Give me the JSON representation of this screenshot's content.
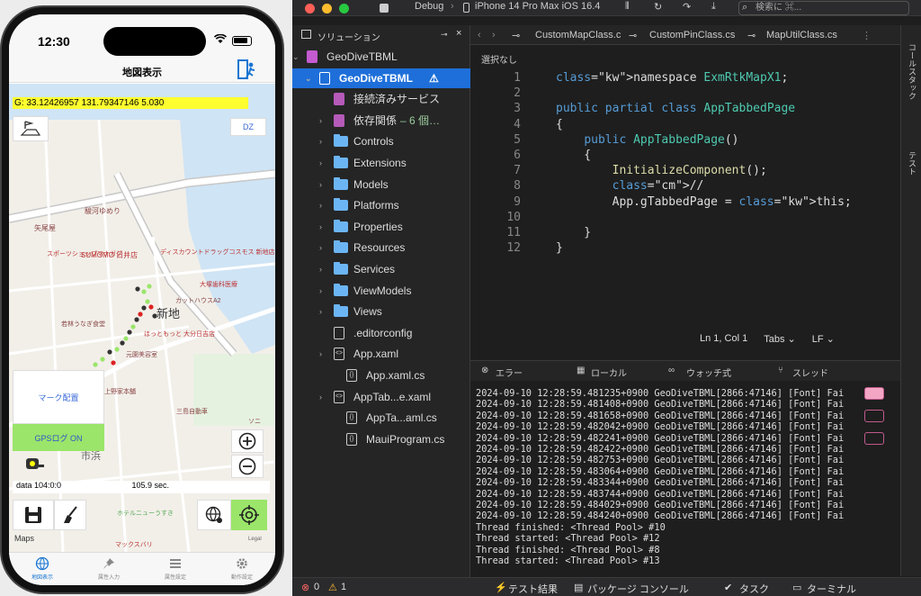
{
  "phone": {
    "time": "12:30",
    "nav_title": "地図表示",
    "gps_text": "G: 33.12426957 131.79347146 5.030",
    "dz_label": "DZ",
    "mark_label": "マーク配置",
    "gpslog_label": "GPSログ ON",
    "data_text": "data 104:0:0",
    "seconds_text": "105.9 sec.",
    "maps_label": "Maps",
    "legal_label": "Legal",
    "map_labels": [
      "新地",
      "市浜",
      "駿河ゆめり",
      "矢尾屋",
      "SUMOMO 日井店",
      "ディスカウントドラッグコスモス 新地店",
      "スポーツショップマナガグ",
      "大塚歯科医療",
      "カットハウスA2",
      "ほっともっと 大分日吉店",
      "若林うなぎ食堂",
      "元園美容室",
      "上野家本舗",
      "三島自動車",
      "ホテルニューうすき",
      "マックスバリ",
      "ソニ"
    ],
    "tabs": [
      {
        "label": "地図表示",
        "icon": "globe-icon"
      },
      {
        "label": "属性入力",
        "icon": "pin-icon"
      },
      {
        "label": "属性設定",
        "icon": "list-icon"
      },
      {
        "label": "動作設定",
        "icon": "gear-icon"
      }
    ]
  },
  "ide": {
    "debug_label": "Debug",
    "device_label": "iPhone 14 Pro Max iOS 16.4",
    "search_placeholder": "検索に ⌘...",
    "solution_title": "ソリューション",
    "tree": [
      {
        "label": "GeoDiveTBML",
        "kind": "solution"
      },
      {
        "label": "GeoDiveTBML",
        "kind": "project",
        "selected": true
      },
      {
        "label": "接続済みサービス",
        "kind": "service"
      },
      {
        "label": "依存関係",
        "kind": "deps",
        "suffix": "– 6 個…"
      },
      {
        "label": "Controls",
        "kind": "folder"
      },
      {
        "label": "Extensions",
        "kind": "folder"
      },
      {
        "label": "Models",
        "kind": "folder"
      },
      {
        "label": "Platforms",
        "kind": "folder"
      },
      {
        "label": "Properties",
        "kind": "folder"
      },
      {
        "label": "Resources",
        "kind": "folder"
      },
      {
        "label": "Services",
        "kind": "folder"
      },
      {
        "label": "ViewModels",
        "kind": "folder"
      },
      {
        "label": "Views",
        "kind": "folder"
      },
      {
        "label": ".editorconfig",
        "kind": "file"
      },
      {
        "label": "App.xaml",
        "kind": "xaml"
      },
      {
        "label": "App.xaml.cs",
        "kind": "cs"
      },
      {
        "label": "AppTab...e.xaml",
        "kind": "xaml"
      },
      {
        "label": "AppTa...aml.cs",
        "kind": "cs"
      },
      {
        "label": "MauiProgram.cs",
        "kind": "cs"
      }
    ],
    "editor_tabs": [
      "CustomMapClass.c",
      "CustomPinClass.cs",
      "MapUtilClass.cs"
    ],
    "breadcrumb": "選択なし",
    "code": [
      {
        "n": "1",
        "t": "namespace ExmRtkMapX1;"
      },
      {
        "n": "2",
        "t": ""
      },
      {
        "n": "3",
        "t": "public partial class AppTabbedPage"
      },
      {
        "n": "4",
        "t": "{"
      },
      {
        "n": "5",
        "t": "    public AppTabbedPage()"
      },
      {
        "n": "6",
        "t": "    {"
      },
      {
        "n": "7",
        "t": "        InitializeComponent();"
      },
      {
        "n": "8",
        "t": "        //"
      },
      {
        "n": "9",
        "t": "        App.gTabbedPage = this;"
      },
      {
        "n": "10",
        "t": ""
      },
      {
        "n": "11",
        "t": "    }"
      },
      {
        "n": "12",
        "t": "}"
      }
    ],
    "cursor_pos": "Ln 1, Col 1",
    "indent": "Tabs",
    "line_end": "LF",
    "bottom_tabs": [
      "エラー",
      "ローカル",
      "ウォッチ式",
      "スレッド"
    ],
    "logs": [
      "2024-09-10 12:28:59.481235+0900 GeoDiveTBML[2866:47146] [Font] Fai",
      "2024-09-10 12:28:59.481408+0900 GeoDiveTBML[2866:47146] [Font] Fai",
      "2024-09-10 12:28:59.481658+0900 GeoDiveTBML[2866:47146] [Font] Fai",
      "2024-09-10 12:28:59.482042+0900 GeoDiveTBML[2866:47146] [Font] Fai",
      "2024-09-10 12:28:59.482241+0900 GeoDiveTBML[2866:47146] [Font] Fai",
      "2024-09-10 12:28:59.482422+0900 GeoDiveTBML[2866:47146] [Font] Fai",
      "2024-09-10 12:28:59.482753+0900 GeoDiveTBML[2866:47146] [Font] Fai",
      "2024-09-10 12:28:59.483064+0900 GeoDiveTBML[2866:47146] [Font] Fai",
      "2024-09-10 12:28:59.483344+0900 GeoDiveTBML[2866:47146] [Font] Fai",
      "2024-09-10 12:28:59.483744+0900 GeoDiveTBML[2866:47146] [Font] Fai",
      "2024-09-10 12:28:59.484029+0900 GeoDiveTBML[2866:47146] [Font] Fai",
      "2024-09-10 12:28:59.484240+0900 GeoDiveTBML[2866:47146] [Font] Fai",
      "Thread finished: <Thread Pool> #10",
      "Thread started: <Thread Pool> #12",
      "Thread finished: <Thread Pool> #8",
      "Thread started: <Thread Pool> #13"
    ],
    "right_rail": [
      "コールスタック",
      "テスト"
    ],
    "footer": {
      "errors": "0",
      "warnings": "1",
      "test": "テスト結果",
      "pkg": "パッケージ コンソール",
      "task": "タスク",
      "terminal": "ターミナル"
    }
  },
  "colors": {
    "accent": "#1e6fd9",
    "gps_yellow": "#ffff2f",
    "gps_green": "#9be56a",
    "keyword": "#c586c0"
  }
}
